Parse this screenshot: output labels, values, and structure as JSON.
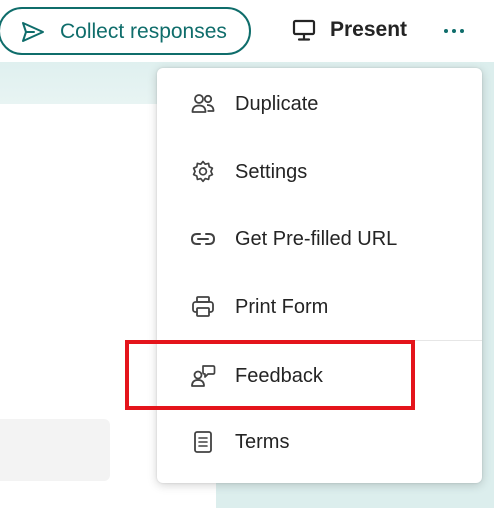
{
  "toolbar": {
    "collect_label": "Collect responses",
    "present_label": "Present",
    "more_icon": "more-horizontal-icon"
  },
  "menu": {
    "items": [
      {
        "label": "Duplicate",
        "icon": "duplicate-icon"
      },
      {
        "label": "Settings",
        "icon": "gear-icon"
      },
      {
        "label": "Get Pre-filled URL",
        "icon": "link-icon"
      },
      {
        "label": "Print Form",
        "icon": "printer-icon"
      },
      {
        "label": "Feedback",
        "icon": "feedback-icon",
        "highlighted": true
      },
      {
        "label": "Terms",
        "icon": "document-icon"
      }
    ]
  },
  "colors": {
    "accent": "#0f6d6b",
    "highlight": "#e4141b",
    "band": "#dff0ef"
  }
}
